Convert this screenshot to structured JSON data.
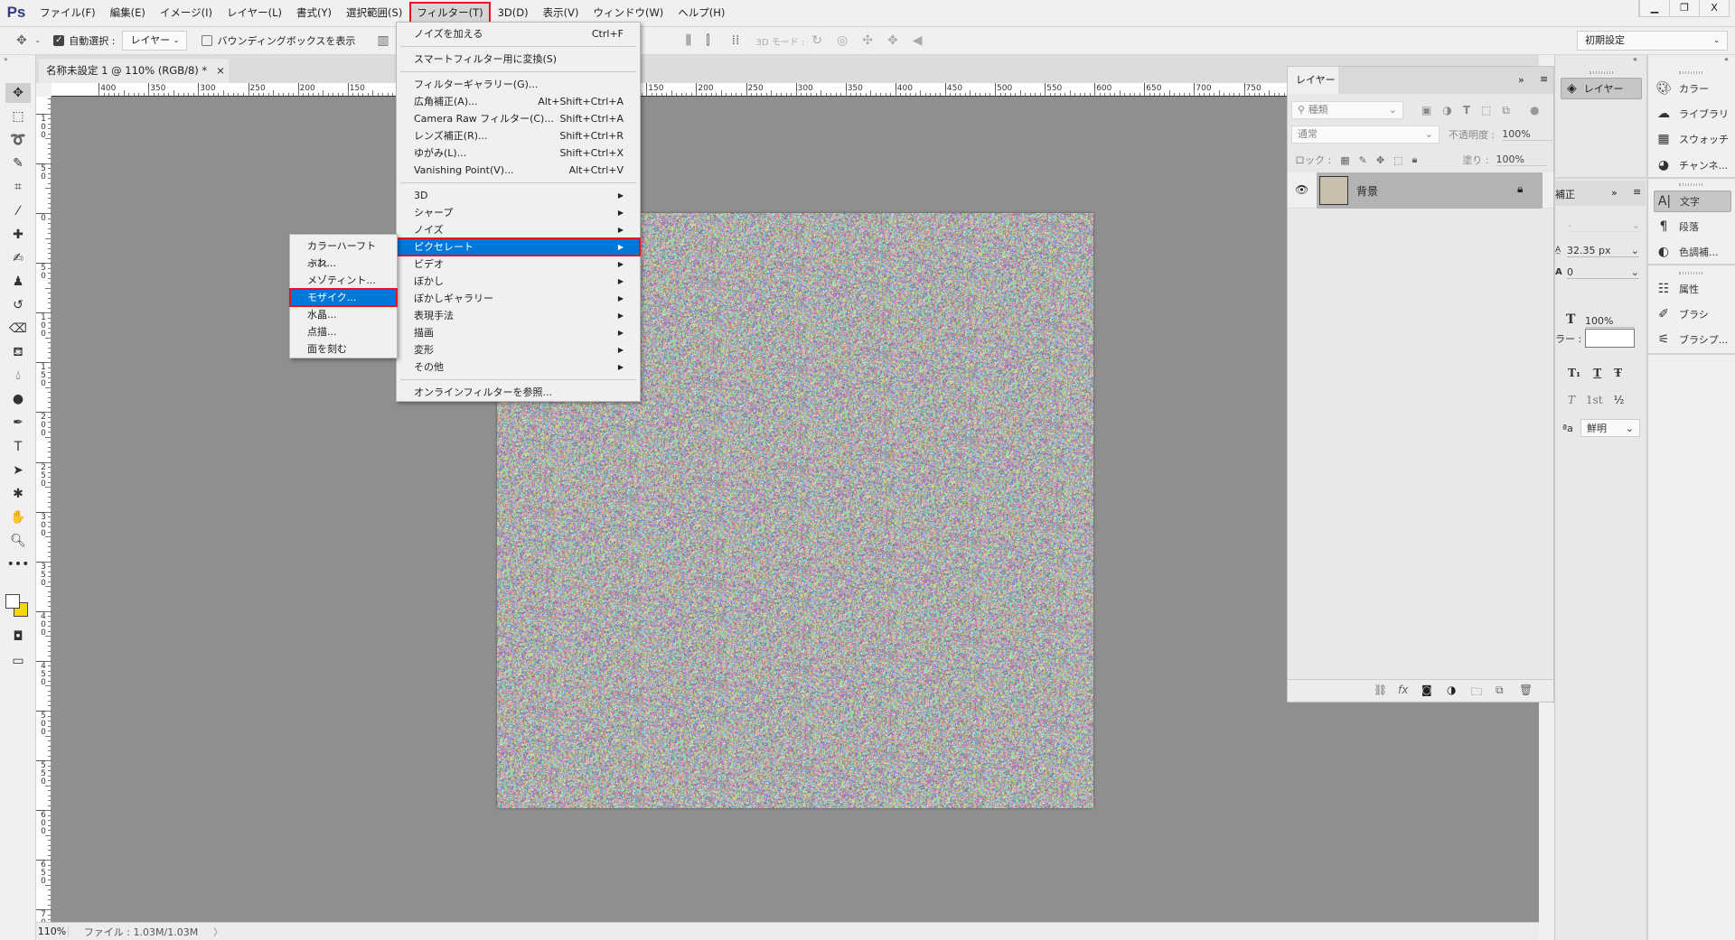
{
  "colors": {
    "accent": "#0078d7",
    "highlight_outline": "#e81123",
    "canvas_bg": "#8f8f8f"
  },
  "app": {
    "logo": "Ps"
  },
  "menubar": {
    "items": [
      "ファイル(F)",
      "編集(E)",
      "イメージ(I)",
      "レイヤー(L)",
      "書式(Y)",
      "選択範囲(S)",
      "フィルター(T)",
      "3D(D)",
      "表示(V)",
      "ウィンドウ(W)",
      "ヘルプ(H)"
    ],
    "open_index": 6
  },
  "window_controls": {
    "minimize": "▁",
    "restore": "❐",
    "close": "X"
  },
  "options": {
    "auto_select_label": "自動選択 :",
    "auto_select_checked": true,
    "target": "レイヤー",
    "bounding_box_label": "バウンディングボックスを表示",
    "bounding_box_checked": false,
    "mode_3d_label": "3D モード :",
    "workspace": "初期設定"
  },
  "document": {
    "tab_title": "名称未設定 1 @ 110% (RGB/8) *",
    "close": "×"
  },
  "rulers": {
    "h_labels": [
      "400",
      "350",
      "300",
      "250",
      "200",
      "150",
      "100",
      "50",
      "0",
      "50",
      "100",
      "150",
      "200",
      "250",
      "300",
      "350",
      "400",
      "450",
      "500",
      "550",
      "600",
      "650",
      "700",
      "750"
    ],
    "v_labels": [
      "100",
      "50",
      "0",
      "50",
      "100",
      "150",
      "200",
      "250",
      "300",
      "350",
      "400",
      "450",
      "500",
      "550",
      "600",
      "650",
      "700"
    ]
  },
  "filter_menu": {
    "items": [
      {
        "label": "ノイズを加える",
        "shortcut": "Ctrl+F"
      },
      {
        "sep": true
      },
      {
        "label": "スマートフィルター用に変換(S)"
      },
      {
        "sep": true
      },
      {
        "label": "フィルターギャラリー(G)..."
      },
      {
        "label": "広角補正(A)...",
        "shortcut": "Alt+Shift+Ctrl+A"
      },
      {
        "label": "Camera Raw フィルター(C)...",
        "shortcut": "Shift+Ctrl+A"
      },
      {
        "label": "レンズ補正(R)...",
        "shortcut": "Shift+Ctrl+R"
      },
      {
        "label": "ゆがみ(L)...",
        "shortcut": "Shift+Ctrl+X"
      },
      {
        "label": "Vanishing Point(V)...",
        "shortcut": "Alt+Ctrl+V"
      },
      {
        "sep": true
      },
      {
        "label": "3D",
        "submenu": true
      },
      {
        "label": "シャープ",
        "submenu": true
      },
      {
        "label": "ノイズ",
        "submenu": true
      },
      {
        "label": "ピクセレート",
        "submenu": true,
        "highlighted": true
      },
      {
        "label": "ビデオ",
        "submenu": true
      },
      {
        "label": "ぼかし",
        "submenu": true
      },
      {
        "label": "ぼかしギャラリー",
        "submenu": true
      },
      {
        "label": "表現手法",
        "submenu": true
      },
      {
        "label": "描画",
        "submenu": true
      },
      {
        "label": "変形",
        "submenu": true
      },
      {
        "label": "その他",
        "submenu": true
      },
      {
        "sep": true
      },
      {
        "label": "オンラインフィルターを参照..."
      }
    ]
  },
  "pixelate_submenu": {
    "items": [
      {
        "label": "カラーハーフトーン..."
      },
      {
        "label": "ぶれ"
      },
      {
        "label": "メゾティント..."
      },
      {
        "label": "モザイク...",
        "highlighted": true
      },
      {
        "label": "水晶..."
      },
      {
        "label": "点描..."
      },
      {
        "label": "面を刻む"
      }
    ]
  },
  "layers_panel": {
    "tab": "レイヤー",
    "filter_kind": "種類",
    "blend_mode": "通常",
    "opacity_label": "不透明度 :",
    "opacity": "100%",
    "lock_label": "ロック :",
    "fill_label": "塗り :",
    "fill": "100%",
    "layers": [
      {
        "name": "背景",
        "visible": true,
        "locked": true,
        "selected": true
      }
    ]
  },
  "middle_panel": {
    "layers_button": "レイヤー",
    "tab": "補正",
    "font_style": "-",
    "leading": "32.35 px",
    "tracking": "0",
    "h_scale": "100%",
    "color_label": "ラー :",
    "anti_alias": "鮮明",
    "glyphs": [
      "T₁",
      "T",
      "Ŧ",
      "1st",
      "½"
    ]
  },
  "right_panel": {
    "groups": [
      [
        {
          "label": "カラー",
          "icon": "palette-icon"
        },
        {
          "label": "ライブラリ",
          "icon": "cc-libraries-icon"
        },
        {
          "label": "スウォッチ",
          "icon": "grid-icon"
        },
        {
          "label": "チャンネ...",
          "icon": "channels-icon"
        }
      ],
      [
        {
          "label": "文字",
          "icon": "character-icon",
          "selected": true
        },
        {
          "label": "段落",
          "icon": "paragraph-icon"
        },
        {
          "label": "色調補...",
          "icon": "adjustments-icon"
        }
      ],
      [
        {
          "label": "属性",
          "icon": "properties-icon"
        },
        {
          "label": "ブラシ",
          "icon": "brush-icon"
        },
        {
          "label": "ブラシプ...",
          "icon": "brush-presets-icon"
        }
      ]
    ]
  },
  "status": {
    "zoom": "110%",
    "file_info": "ファイル : 1.03M/1.03M",
    "arrow": "〉"
  }
}
